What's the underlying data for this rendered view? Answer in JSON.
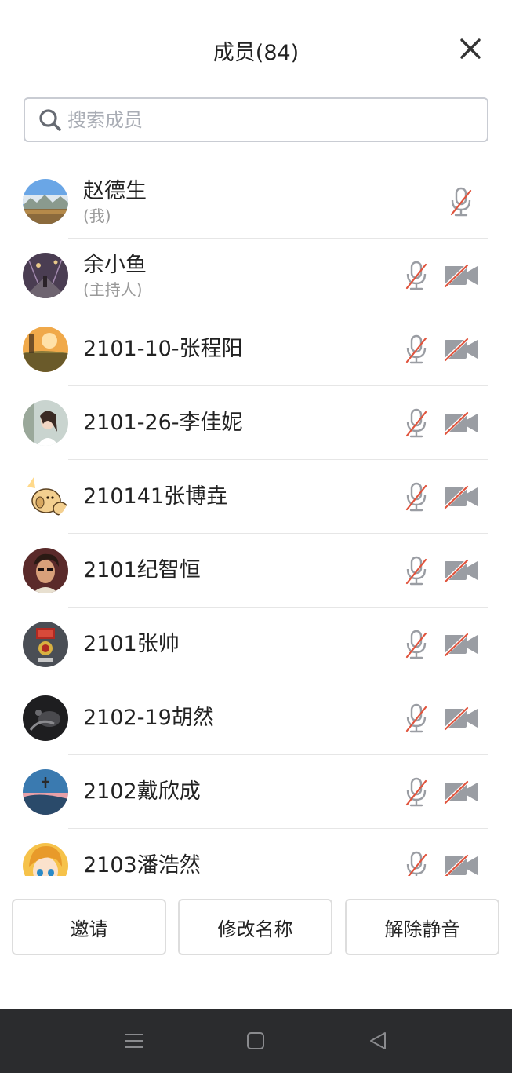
{
  "header": {
    "title": "成员(84)"
  },
  "search": {
    "placeholder": "搜索成员",
    "value": ""
  },
  "members": [
    {
      "name": "赵德生",
      "role": "(我)",
      "avatar": "landscape-avatar",
      "mic": "muted",
      "camera": null
    },
    {
      "name": "余小鱼",
      "role": "(主持人)",
      "avatar": "night-street-avatar",
      "mic": "muted",
      "camera": "off"
    },
    {
      "name": "2101-10-张程阳",
      "role": "",
      "avatar": "sunset-avatar",
      "mic": "muted",
      "camera": "off"
    },
    {
      "name": "2101-26-李佳妮",
      "role": "",
      "avatar": "girl-photo-avatar",
      "mic": "muted",
      "camera": "off"
    },
    {
      "name": "210141张博垚",
      "role": "",
      "avatar": "cartoon-dog-avatar",
      "mic": "muted",
      "camera": "off"
    },
    {
      "name": "2101纪智恒",
      "role": "",
      "avatar": "anime-man-avatar",
      "mic": "muted",
      "camera": "off"
    },
    {
      "name": "2101张帅",
      "role": "",
      "avatar": "medal-avatar",
      "mic": "muted",
      "camera": "off"
    },
    {
      "name": "2102-19胡然",
      "role": "",
      "avatar": "dark-photo-avatar",
      "mic": "muted",
      "camera": "off"
    },
    {
      "name": "2102戴欣成",
      "role": "",
      "avatar": "sky-photo-avatar",
      "mic": "muted",
      "camera": "off"
    },
    {
      "name": "2103潘浩然",
      "role": "",
      "avatar": "anime-girl-avatar",
      "mic": "muted",
      "camera": "off"
    }
  ],
  "actions": {
    "invite": "邀请",
    "rename": "修改名称",
    "unmute": "解除静音"
  },
  "colors": {
    "muted_slash": "#e0533c",
    "icon_gray": "#9a9da3",
    "navbar": "#2b2c2e"
  }
}
